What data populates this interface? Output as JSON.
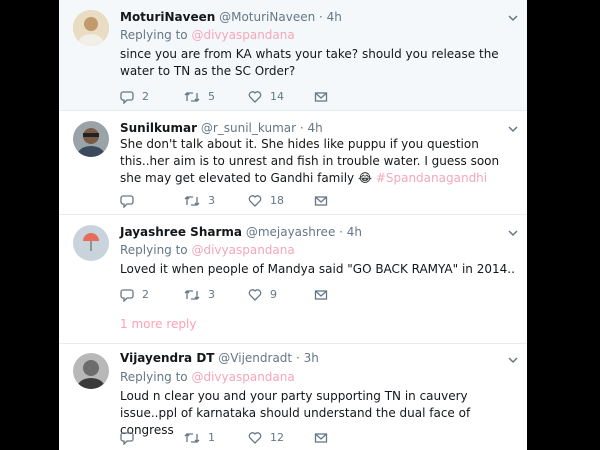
{
  "tweets": [
    {
      "name": "MoturiNaveen",
      "handle": "@MoturiNaveen",
      "time": "· 4h",
      "reply_prefix": "Replying to ",
      "reply_user": "@divyaspandana",
      "text": "since you are from KA whats your take? should you release the water to TN as the SC Order?",
      "replies": "2",
      "retweets": "5",
      "likes": "14"
    },
    {
      "name": "Sunilkumar",
      "handle": "@r_sunil_kumar",
      "time": "· 4h",
      "text": "She don't talk about it. She hides like puppu if you question this..her aim is to unrest and fish in trouble water. I guess soon she may get elevated to Gandhi family ",
      "emoji": "😂",
      "hashtag": "#Spandanagandhi",
      "replies": "",
      "retweets": "3",
      "likes": "18"
    },
    {
      "name": "Jayashree Sharma",
      "handle": "@mejayashree",
      "time": "· 4h",
      "reply_prefix": "Replying to ",
      "reply_user": "@divyaspandana",
      "text": "Loved it when people of Mandya said \"GO BACK RAMYA\" in 2014..",
      "replies": "2",
      "retweets": "3",
      "likes": "9"
    },
    {
      "name": "Vijayendra DT",
      "handle": "@Vijendradt",
      "time": "· 3h",
      "reply_prefix": "Replying to ",
      "reply_user": "@divyaspandana",
      "text": "Loud n clear you and your party supporting TN in cauvery issue..ppl of karnataka should understand the dual face of congress",
      "replies": "",
      "retweets": "1",
      "likes": "12"
    }
  ],
  "more_replies": "1 more reply",
  "icons": [
    "reply-icon",
    "retweet-icon",
    "like-icon",
    "message-icon",
    "chevron-down-icon"
  ],
  "colors": {
    "link": "#f4a7b9",
    "muted": "#657786",
    "highlight_bg": "#f5f8fa"
  }
}
